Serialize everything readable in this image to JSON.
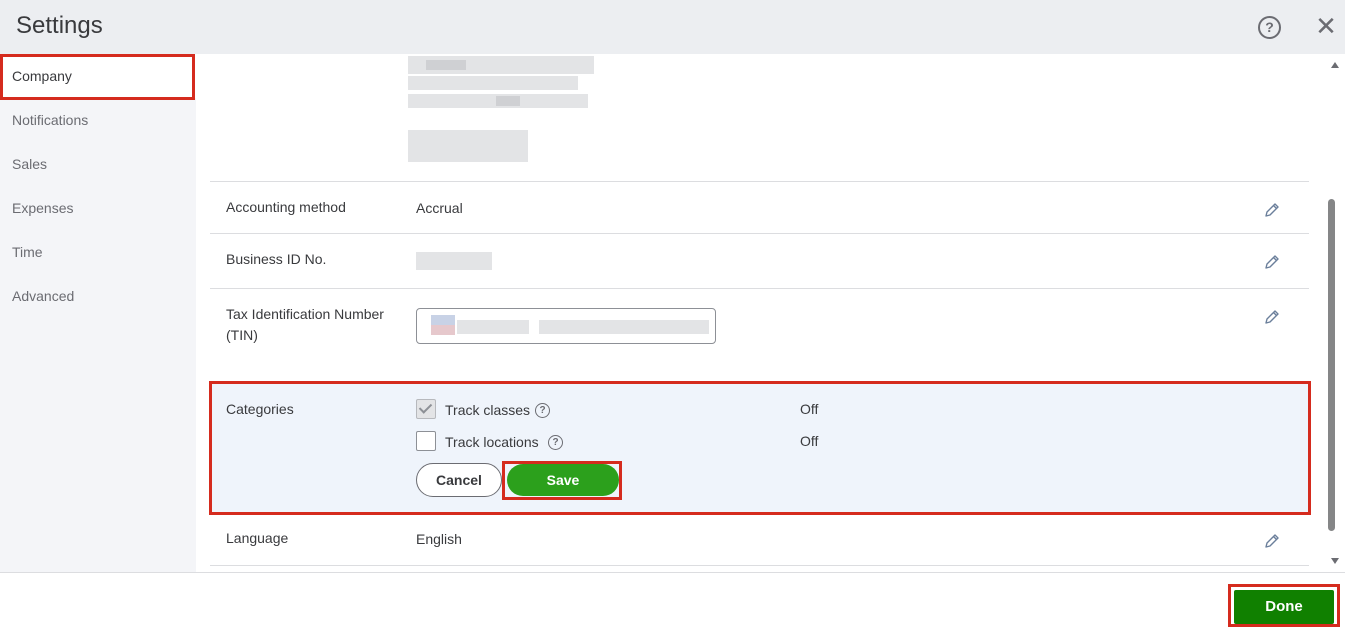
{
  "header": {
    "title": "Settings",
    "help_icon": "help-icon",
    "help_glyph": "?",
    "close_icon": "close-icon",
    "close_glyph": "✕"
  },
  "sidebar": {
    "active": "Company",
    "items": [
      {
        "label": "Company"
      },
      {
        "label": "Notifications"
      },
      {
        "label": "Sales"
      },
      {
        "label": "Expenses"
      },
      {
        "label": "Time"
      },
      {
        "label": "Advanced"
      }
    ]
  },
  "company": {
    "accounting_method": {
      "label": "Accounting method",
      "value": "Accrual"
    },
    "business_id": {
      "label": "Business ID No."
    },
    "tin": {
      "label": "Tax Identification Number (TIN)"
    },
    "categories": {
      "label": "Categories",
      "track_classes": {
        "label": "Track classes",
        "checked": true,
        "status": "Off"
      },
      "track_locations": {
        "label": "Track locations",
        "checked": false,
        "status": "Off"
      },
      "cancel_label": "Cancel",
      "save_label": "Save"
    },
    "language": {
      "label": "Language",
      "value": "English"
    }
  },
  "footer": {
    "done_label": "Done"
  },
  "colors": {
    "accent_green": "#2ca01c",
    "done_green": "#108000",
    "highlight_red": "#d52b1e",
    "panel_blue": "#eff4fb"
  }
}
